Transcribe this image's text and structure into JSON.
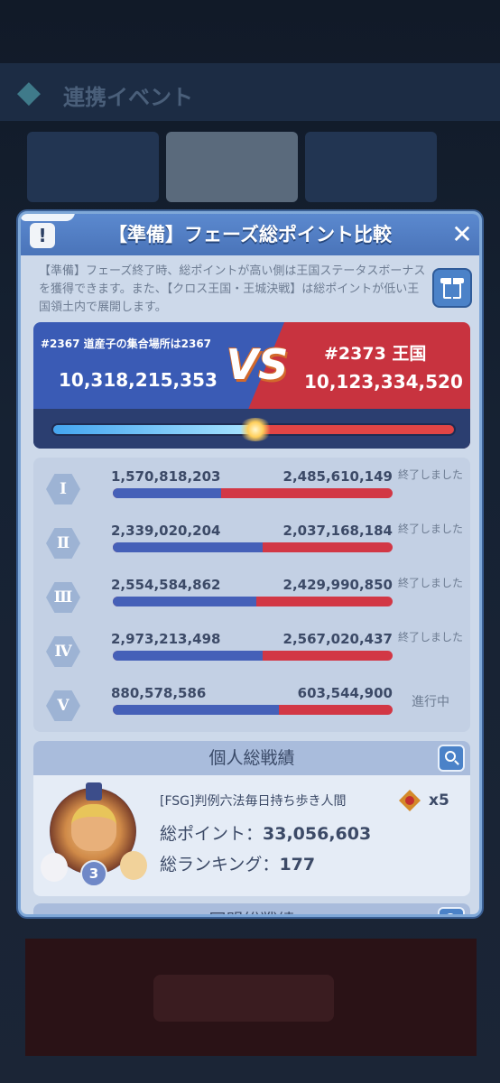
{
  "background": {
    "title": "連携イベント"
  },
  "modal": {
    "info_icon": "!",
    "title": "【準備】フェーズ総ポイント比較",
    "close_icon": "✕",
    "description": "【準備】フェーズ終了時、総ポイントが高い側は王国ステータスボーナスを獲得できます。また、【クロス王国・王城決戦】は総ポイントが低い王国領土内で展開します。"
  },
  "versus": {
    "left_kingdom": "#2367 道産子の集合場所は2367",
    "left_total": "10,318,215,353",
    "vs_label": "VS",
    "right_kingdom": "#2373 王国",
    "right_total": "10,123,334,520",
    "left_share": 0.5048,
    "colors": {
      "left": "#3a5bb5",
      "right": "#c8333f"
    }
  },
  "phases": [
    {
      "numeral": "Ⅰ",
      "left": "1,570,818,203",
      "right": "2,485,610,149",
      "left_share": 0.387,
      "status": "終了しました"
    },
    {
      "numeral": "Ⅱ",
      "left": "2,339,020,204",
      "right": "2,037,168,184",
      "left_share": 0.534,
      "status": "終了しました"
    },
    {
      "numeral": "Ⅲ",
      "left": "2,554,584,862",
      "right": "2,429,990,850",
      "left_share": 0.512,
      "status": "終了しました"
    },
    {
      "numeral": "Ⅳ",
      "left": "2,973,213,498",
      "right": "2,567,020,437",
      "left_share": 0.537,
      "status": "終了しました"
    },
    {
      "numeral": "Ⅴ",
      "left": "880,578,586",
      "right": "603,544,900",
      "left_share": 0.593,
      "status": "進行中"
    }
  ],
  "personal": {
    "title": "個人総戦績",
    "search_icon": "search-icon",
    "player_name": "[FSG]判例六法毎日持ち歩き人間",
    "medal_count": "x5",
    "avatar_level": "3",
    "total_points_label": "総ポイント：",
    "total_points": "33,056,603",
    "total_rank_label": "総ランキング：",
    "total_rank": "177"
  },
  "alliance": {
    "title": "同盟総戦績",
    "search_icon": "search-icon"
  }
}
